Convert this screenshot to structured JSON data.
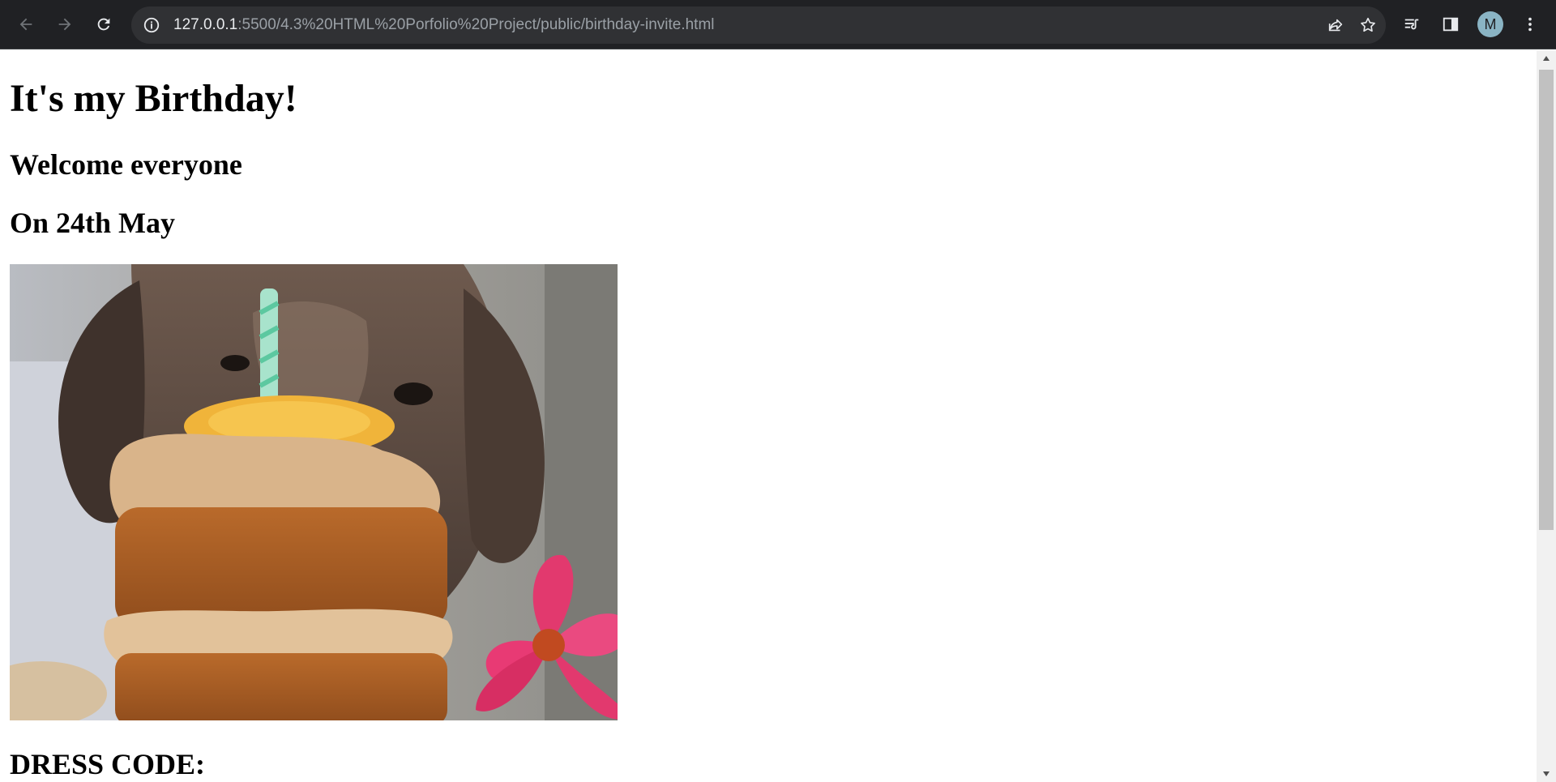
{
  "browser": {
    "url_host": "127.0.0.1",
    "url_rest": ":5500/4.3%20HTML%20Porfolio%20Project/public/birthday-invite.html",
    "avatar_initial": "M"
  },
  "page": {
    "title": "It's my Birthday!",
    "welcome": "Welcome everyone",
    "date": "On 24th May",
    "dress_code": "DRESS CODE:"
  },
  "icons": {
    "back": "arrow-left-icon",
    "forward": "arrow-right-icon",
    "reload": "reload-icon",
    "info": "info-icon",
    "share": "share-icon",
    "bookmark": "star-icon",
    "reading_list": "reading-list-icon",
    "side_panel": "side-panel-icon",
    "menu": "kebab-menu-icon"
  },
  "colors": {
    "chrome_bg": "#202124",
    "omnibox_bg": "#303134",
    "page_bg": "#ffffff"
  }
}
